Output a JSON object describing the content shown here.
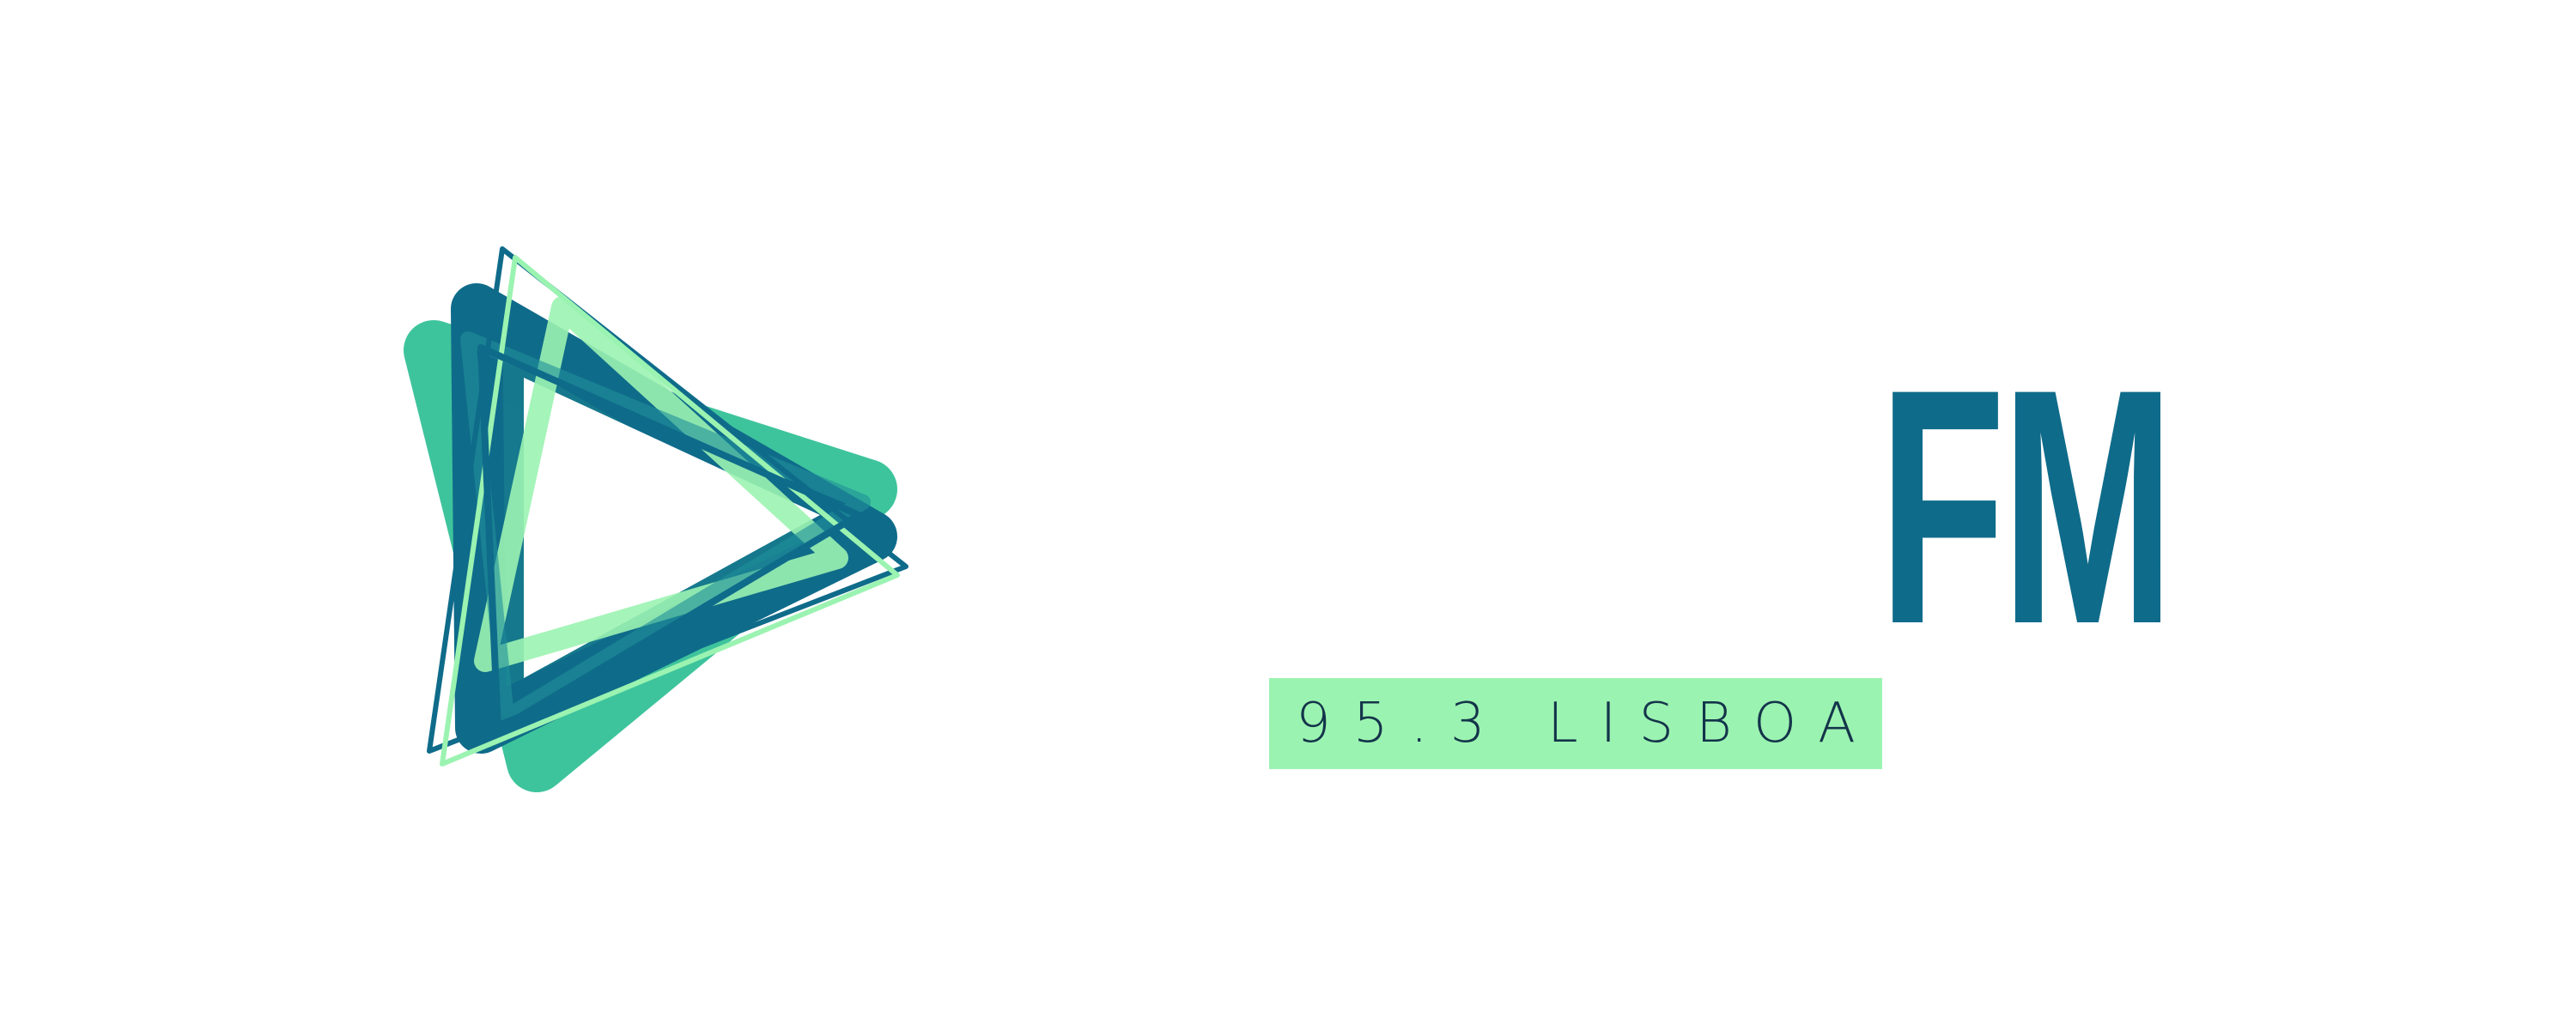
{
  "brand": {
    "wordmark": "FM",
    "frequency": "95.3 LISBOA"
  },
  "colors": {
    "primary": "#0f6b8a",
    "teal": "#3ec49c",
    "mint": "#9bf3b1",
    "dark": "#14344a",
    "background": "#ffffff"
  }
}
